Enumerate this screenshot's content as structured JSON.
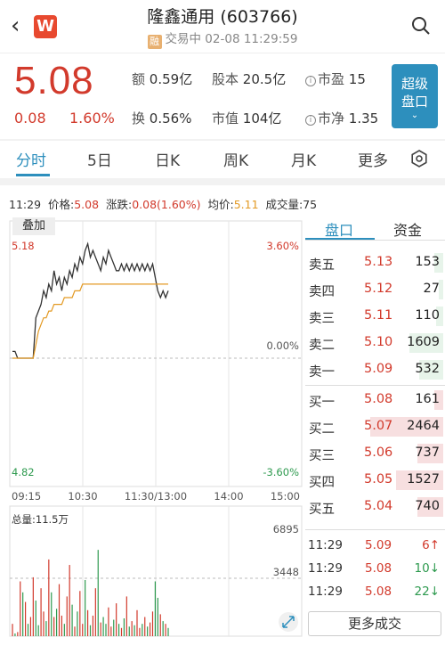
{
  "header": {
    "title": "隆鑫通用 (603766)",
    "badge": "融",
    "status": "交易中 02-08 11:29:59",
    "logo_letter": "W"
  },
  "quote": {
    "price": "5.08",
    "change": "0.08",
    "change_pct": "1.60%",
    "stats": {
      "amount_label": "额",
      "amount": "0.59亿",
      "shares_label": "股本",
      "shares": "20.5亿",
      "pe_label": "市盈",
      "pe": "15",
      "turnover_label": "换",
      "turnover": "0.56%",
      "mcap_label": "市值",
      "mcap": "104亿",
      "pb_label": "市净",
      "pb": "1.35"
    },
    "super_button": [
      "超级",
      "盘口"
    ]
  },
  "tabs": [
    "分时",
    "5日",
    "日K",
    "周K",
    "月K",
    "更多"
  ],
  "active_tab": 0,
  "info_bar": {
    "time": "11:29",
    "price_label": "价格:",
    "price": "5.08",
    "change_label": "涨跌:",
    "change": "0.08(1.60%)",
    "avg_label": "均价:",
    "avg": "5.11",
    "volume_label": "成交量:",
    "volume": "75"
  },
  "overlay_button": "叠加",
  "chart_data": {
    "type": "line",
    "y_max_label": "5.18",
    "y_min_label": "4.82",
    "pct_max_label": "3.60%",
    "pct_mid_label": "0.00%",
    "pct_min_label": "-3.60%",
    "x_labels": [
      "09:15",
      "10:30",
      "11:30/13:00",
      "14:00",
      "15:00"
    ],
    "prev_close": 5.0,
    "ylim": [
      4.82,
      5.18
    ],
    "price_series": [
      5.01,
      5.01,
      5.0,
      5.0,
      5.0,
      5.0,
      5.0,
      5.0,
      5.0,
      5.06,
      5.07,
      5.08,
      5.1,
      5.09,
      5.11,
      5.1,
      5.13,
      5.11,
      5.12,
      5.1,
      5.12,
      5.11,
      5.13,
      5.12,
      5.14,
      5.13,
      5.15,
      5.14,
      5.16,
      5.17,
      5.15,
      5.16,
      5.15,
      5.14,
      5.13,
      5.15,
      5.14,
      5.16,
      5.15,
      5.14,
      5.13,
      5.13,
      5.14,
      5.13,
      5.14,
      5.13,
      5.14,
      5.13,
      5.14,
      5.13,
      5.14,
      5.13,
      5.14,
      5.13,
      5.14,
      5.12,
      5.1,
      5.09,
      5.1,
      5.09,
      5.1
    ],
    "avg_series": [
      5.0,
      5.0,
      5.0,
      5.0,
      5.0,
      5.0,
      5.0,
      5.0,
      5.0,
      5.02,
      5.04,
      5.05,
      5.06,
      5.06,
      5.07,
      5.07,
      5.08,
      5.08,
      5.08,
      5.08,
      5.09,
      5.09,
      5.09,
      5.09,
      5.1,
      5.1,
      5.1,
      5.11,
      5.11,
      5.11,
      5.11,
      5.11,
      5.11,
      5.11,
      5.11,
      5.11,
      5.11,
      5.11,
      5.11,
      5.11,
      5.11,
      5.11,
      5.11,
      5.11,
      5.11,
      5.11,
      5.11,
      5.11,
      5.11,
      5.11,
      5.11,
      5.11,
      5.11,
      5.11,
      5.11,
      5.11,
      5.11,
      5.11,
      5.11,
      5.11,
      5.11
    ],
    "volume_title": "总量:11.5万",
    "volume_max_label": "6895",
    "volume_mid_label": "3448",
    "volume_max": 6895,
    "volumes": [
      900,
      200,
      300,
      4000,
      3200,
      2500,
      900,
      1400,
      4300,
      2600,
      800,
      3500,
      1800,
      1100,
      5600,
      3200,
      1400,
      2000,
      3800,
      1500,
      900,
      2900,
      5200,
      2300,
      700,
      1800,
      3300,
      900,
      4100,
      1900,
      800,
      1500,
      3500,
      6300,
      1000,
      1400,
      900,
      2100,
      700,
      1200,
      2400,
      900,
      600,
      1300,
      2900,
      700,
      1100,
      800,
      1900,
      600,
      900,
      1400,
      700,
      1000,
      1800,
      4000,
      2800,
      1600,
      1100,
      900,
      600
    ],
    "volume_colors": [
      "r",
      "g",
      "r",
      "r",
      "g",
      "r",
      "g",
      "r",
      "r",
      "g",
      "g",
      "r",
      "r",
      "g",
      "r",
      "g",
      "r",
      "g",
      "r",
      "r",
      "g",
      "r",
      "r",
      "g",
      "r",
      "g",
      "r",
      "r",
      "g",
      "r",
      "g",
      "r",
      "r",
      "g",
      "r",
      "g",
      "g",
      "r",
      "r",
      "g",
      "r",
      "g",
      "r",
      "g",
      "r",
      "g",
      "r",
      "g",
      "r",
      "r",
      "g",
      "r",
      "g",
      "r",
      "r",
      "g",
      "g",
      "r",
      "g",
      "r",
      "g"
    ]
  },
  "right_tabs": [
    "盘口",
    "资金"
  ],
  "order_book": {
    "asks": [
      {
        "label": "卖五",
        "price": "5.13",
        "vol": "153",
        "w": 0.1
      },
      {
        "label": "卖四",
        "price": "5.12",
        "vol": "27",
        "w": 0.05
      },
      {
        "label": "卖三",
        "price": "5.11",
        "vol": "110",
        "w": 0.08
      },
      {
        "label": "卖二",
        "price": "5.10",
        "vol": "1609",
        "w": 0.4
      },
      {
        "label": "卖一",
        "price": "5.09",
        "vol": "532",
        "w": 0.28
      }
    ],
    "bids": [
      {
        "label": "买一",
        "price": "5.08",
        "vol": "161",
        "w": 0.1
      },
      {
        "label": "买二",
        "price": "5.07",
        "vol": "2464",
        "w": 0.85
      },
      {
        "label": "买三",
        "price": "5.06",
        "vol": "737",
        "w": 0.3
      },
      {
        "label": "买四",
        "price": "5.05",
        "vol": "1527",
        "w": 0.55
      },
      {
        "label": "买五",
        "price": "5.04",
        "vol": "740",
        "w": 0.3
      }
    ]
  },
  "trades": [
    {
      "time": "11:29",
      "price": "5.09",
      "vol": "6",
      "dir": "up",
      "arrow": "↑"
    },
    {
      "time": "11:29",
      "price": "5.08",
      "vol": "10",
      "dir": "dn",
      "arrow": "↓"
    },
    {
      "time": "11:29",
      "price": "5.08",
      "vol": "22",
      "dir": "dn",
      "arrow": "↓"
    }
  ],
  "more_trades_button": "更多成交",
  "colors": {
    "red": "#d23a2c",
    "green": "#2e9a4f",
    "blue": "#2d8fbd",
    "avg_line": "#e39a24"
  }
}
